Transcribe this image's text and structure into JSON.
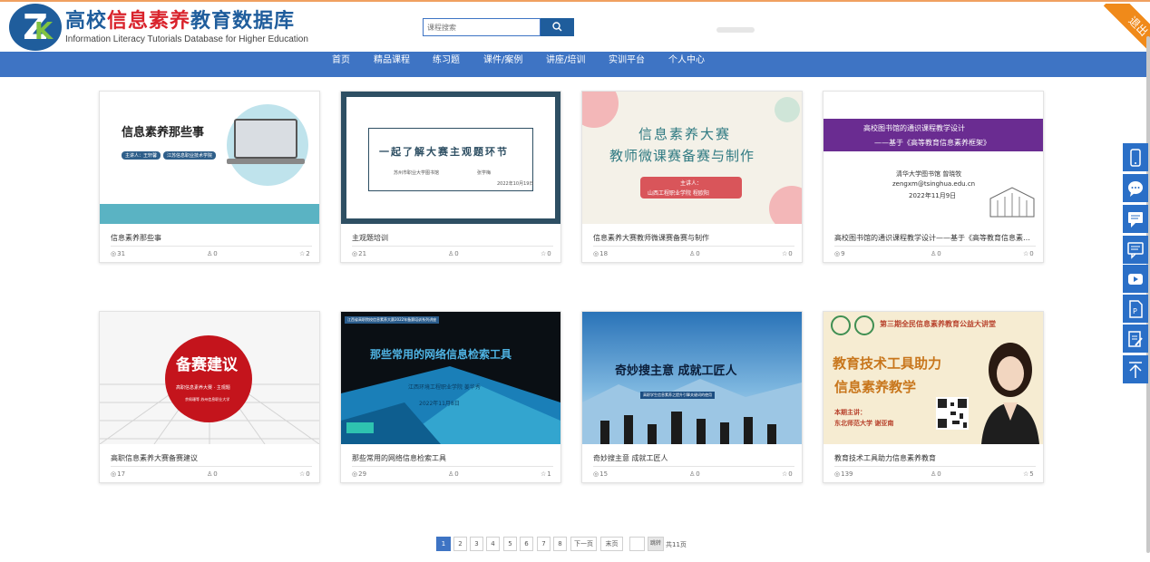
{
  "header": {
    "logo_title_part1": "高校",
    "logo_title_part2": "信息素养",
    "logo_title_part3": "教育数据库",
    "logo_subtitle": "Information Literacy Tutorials Database for Higher Education",
    "search_placeholder": "课程搜索",
    "logout_label": "退出"
  },
  "nav": {
    "items": [
      "首页",
      "精品课程",
      "练习题",
      "课件/案例",
      "讲座/培训",
      "实训平台",
      "个人中心"
    ]
  },
  "cards": [
    {
      "title": "信息素养那些事",
      "views": "31",
      "likes": "0",
      "stars": "2",
      "thumb": {
        "heading": "信息素养那些事",
        "tag1": "主讲人：王轩馨",
        "tag2": "江苏信息职业技术学院"
      }
    },
    {
      "title": "主观题培训",
      "views": "21",
      "likes": "0",
      "stars": "0",
      "thumb": {
        "heading": "一起了解大赛主观题环节",
        "left_note": "苏州市职业大学图书馆",
        "right_note": "张学梅",
        "date": "2022年10月19日"
      }
    },
    {
      "title": "信息素养大赛教师微课赛备赛与制作",
      "views": "18",
      "likes": "0",
      "stars": "0",
      "thumb": {
        "line1": "信息素养大赛",
        "line2": "教师微课赛备赛与制作",
        "presenter_label": "主讲人：",
        "presenter": "山西工程职业学院  程欧阳"
      }
    },
    {
      "title": "高校图书馆的通识课程教学设计——基于《高等教育信息素养框架》",
      "views": "9",
      "likes": "0",
      "stars": "0",
      "thumb": {
        "banner1": "高校图书馆的通识课程教学设计",
        "banner2": "——基于《高等教育信息素养框架》",
        "author": "清华大学图书馆  曾晓牧",
        "email": "zengxm@tsinghua.edu.cn",
        "date": "2022年11月9日"
      }
    },
    {
      "title": "高职信息素养大赛备赛建议",
      "views": "17",
      "likes": "0",
      "stars": "0",
      "thumb": {
        "heading": "备赛建议",
        "sub": "高职信息素养大赛 · 主观题",
        "note": "余佩珊等   苏州信息职业大学"
      }
    },
    {
      "title": "那些常用的网络信息检索工具",
      "views": "29",
      "likes": "0",
      "stars": "1",
      "thumb": {
        "top_note": "江西省高职院校信息素养大赛2022年备赛培训系列讲座",
        "heading": "那些常用的网络信息检索工具",
        "presenter": "江西环境工程职业学院  姜华秀",
        "date": "2022年11月8日"
      }
    },
    {
      "title": "奇妙搜主意 成就工匠人",
      "views": "15",
      "likes": "0",
      "stars": "0",
      "thumb": {
        "heading": "奇妙搜主意 成就工匠人",
        "sub": "高职学生信息素养之提升引擎关键词的使用"
      }
    },
    {
      "title": "教育技术工具助力信息素养教育",
      "views": "139",
      "likes": "0",
      "stars": "5",
      "thumb": {
        "banner": "第三期全民信息素养教育公益大讲堂",
        "heading1": "教育技术工具助力",
        "heading2": "信息素养教学",
        "presenter_label": "本期主讲：",
        "presenter": "东北师范大学  谢亚南"
      }
    }
  ],
  "pagination": {
    "pages": [
      "1",
      "2",
      "3",
      "4",
      "5",
      "6",
      "7",
      "8"
    ],
    "active_page": "1",
    "next_label": "下一页",
    "last_label": "末页",
    "jump_label": "跳转",
    "total_label": "共11页"
  },
  "colors": {
    "nav_bg": "#3e74c4",
    "brand_blue": "#1f5d9c",
    "brand_red": "#d9232c",
    "logout_orange": "#f08a1a",
    "side_button": "#2a6fc7"
  },
  "side_toolbar": [
    "mobile-icon",
    "chat-bubble-icon",
    "message-icon",
    "comment-icon",
    "video-icon",
    "document-icon",
    "edit-icon",
    "back-to-top-icon"
  ]
}
